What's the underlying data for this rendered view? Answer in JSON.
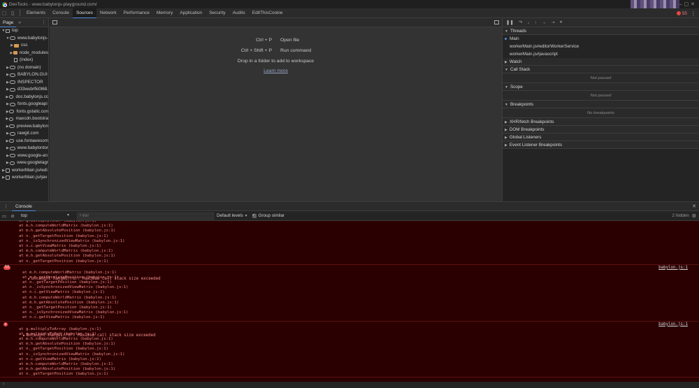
{
  "window": {
    "title": "DevTools - www.babylonjs-playground.com/"
  },
  "devtools_tabs": [
    {
      "label": "Elements",
      "active": false
    },
    {
      "label": "Console",
      "active": false
    },
    {
      "label": "Sources",
      "active": true
    },
    {
      "label": "Network",
      "active": false
    },
    {
      "label": "Performance",
      "active": false
    },
    {
      "label": "Memory",
      "active": false
    },
    {
      "label": "Application",
      "active": false
    },
    {
      "label": "Security",
      "active": false
    },
    {
      "label": "Audits",
      "active": false
    },
    {
      "label": "EditThisCookie",
      "active": false
    }
  ],
  "error_count": "55",
  "navigator": {
    "tab_label": "Page",
    "more": "»",
    "items": [
      {
        "label": "top",
        "icon": "frame-icon",
        "level": 0,
        "arrow": "▼"
      },
      {
        "label": "www.babylonjs-",
        "icon": "cloud-icon",
        "level": 1,
        "arrow": "▼"
      },
      {
        "label": "css",
        "icon": "folder-icon",
        "level": 2,
        "arrow": "▶"
      },
      {
        "label": "node_modules",
        "icon": "folder-icon",
        "level": 2,
        "arrow": "▶"
      },
      {
        "label": "(index)",
        "icon": "file-icon",
        "level": 2,
        "arrow": ""
      },
      {
        "label": "(no domain)",
        "icon": "cloud-icon",
        "level": 1,
        "arrow": "▶"
      },
      {
        "label": "BABYLON.GUI",
        "icon": "cloud-icon",
        "level": 1,
        "arrow": "▶"
      },
      {
        "label": "INSPECTOR",
        "icon": "cloud-icon",
        "level": 1,
        "arrow": "▶"
      },
      {
        "label": "d33wubrfki0l68.",
        "icon": "cloud-icon",
        "level": 1,
        "arrow": "▶"
      },
      {
        "label": "doc.babylonjs.cc",
        "icon": "cloud-icon",
        "level": 1,
        "arrow": "▶"
      },
      {
        "label": "fonts.googleapi",
        "icon": "cloud-icon",
        "level": 1,
        "arrow": "▶"
      },
      {
        "label": "fonts.gstatic.con",
        "icon": "cloud-icon",
        "level": 1,
        "arrow": "▶"
      },
      {
        "label": "maxcdn.bootstra",
        "icon": "cloud-icon",
        "level": 1,
        "arrow": "▶"
      },
      {
        "label": "preview.babylon",
        "icon": "cloud-icon",
        "level": 1,
        "arrow": "▶"
      },
      {
        "label": "rawgit.com",
        "icon": "cloud-icon",
        "level": 1,
        "arrow": "▶"
      },
      {
        "label": "use.fontawesom",
        "icon": "cloud-icon",
        "level": 1,
        "arrow": "▶"
      },
      {
        "label": "www.babylontor",
        "icon": "cloud-icon",
        "level": 1,
        "arrow": "▶"
      },
      {
        "label": "www.google-an",
        "icon": "cloud-icon",
        "level": 1,
        "arrow": "▶"
      },
      {
        "label": "www.googletagr",
        "icon": "cloud-icon",
        "level": 1,
        "arrow": "▶"
      },
      {
        "label": "workerMain.js#edi",
        "icon": "gear-file-icon",
        "level": 0,
        "arrow": "▶"
      },
      {
        "label": "workerMain.js#jav",
        "icon": "gear-file-icon",
        "level": 0,
        "arrow": "▶"
      }
    ]
  },
  "editor": {
    "shortcuts": [
      {
        "key": "Ctrl + P",
        "label": "Open file"
      },
      {
        "key": "Ctrl + Shift + P",
        "label": "Run command"
      }
    ],
    "drop_hint": "Drop in a folder to add to workspace",
    "learn_more": "Learn more"
  },
  "debugger": {
    "threads_header": "Threads",
    "threads": [
      {
        "label": "Main",
        "selected": true
      },
      {
        "label": "workerMain.js#editorWorkerService",
        "selected": false
      },
      {
        "label": "workerMain.js#javascript",
        "selected": false
      }
    ],
    "watch_header": "Watch",
    "call_stack_header": "Call Stack",
    "call_stack_empty": "Not paused",
    "scope_header": "Scope",
    "scope_empty": "Not paused",
    "breakpoints_header": "Breakpoints",
    "breakpoints_empty": "No breakpoints",
    "collapsed_panes": [
      "XHR/fetch Breakpoints",
      "DOM Breakpoints",
      "Global Listeners",
      "Event Listener Breakpoints"
    ]
  },
  "drawer": {
    "tab_label": "Console",
    "context": "top",
    "filter_placeholder": "Filter",
    "levels": "Default levels",
    "group_similar": "Group similar",
    "hidden_count": "2 hidden"
  },
  "console": {
    "first_lines": [
      "at g.multiplyToRef (babylon.js:1)",
      "at m.h.computeWorldMatrix (babylon.js:1)",
      "at m.h.getAbsolutePosition (babylon.js:1)",
      "at n._getTargetPosition (babylon.js:1)",
      "at n._isSynchronizedViewMatrix (babylon.js:1)",
      "at n.c.getViewMatrix (babylon.js:1)",
      "at m.h.computeWorldMatrix (babylon.js:1)",
      "at m.h.getAbsolutePosition (babylon.js:1)",
      "at n._getTargetPosition (babylon.js:1)"
    ],
    "msg2": {
      "badge": "53",
      "text": "Uncaught RangeError: Maximum call stack size exceeded",
      "source": "babylon.js:1",
      "lines": [
        "at m.h.computeWorldMatrix (babylon.js:1)",
        "at m.h.getAbsolutePosition (babylon.js:1)",
        "at n._getTargetPosition (babylon.js:1)",
        "at n._isSynchronizedViewMatrix (babylon.js:1)",
        "at n.c.getViewMatrix (babylon.js:1)",
        "at m.h.computeWorldMatrix (babylon.js:1)",
        "at m.h.getAbsolutePosition (babylon.js:1)",
        "at n._getTargetPosition (babylon.js:1)",
        "at n._isSynchronizedViewMatrix (babylon.js:1)",
        "at n.c.getViewMatrix (babylon.js:1)"
      ]
    },
    "msg3": {
      "text": "Uncaught RangeError: Maximum call stack size exceeded",
      "source": "babylon.js:1",
      "lines": [
        "at g.multiplyToArray (babylon.js:1)",
        "at g.multiplyToRef (babylon.js:1)",
        "at m.h.computeWorldMatrix (babylon.js:1)",
        "at m.h.getAbsolutePosition (babylon.js:1)",
        "at n._getTargetPosition (babylon.js:1)",
        "at n._isSynchronizedViewMatrix (babylon.js:1)",
        "at n.c.getViewMatrix (babylon.js:1)",
        "at m.h.computeWorldMatrix (babylon.js:1)",
        "at m.h.getAbsolutePosition (babylon.js:1)",
        "at n._getTargetPosition (babylon.js:1)"
      ]
    },
    "prompt": "›"
  }
}
